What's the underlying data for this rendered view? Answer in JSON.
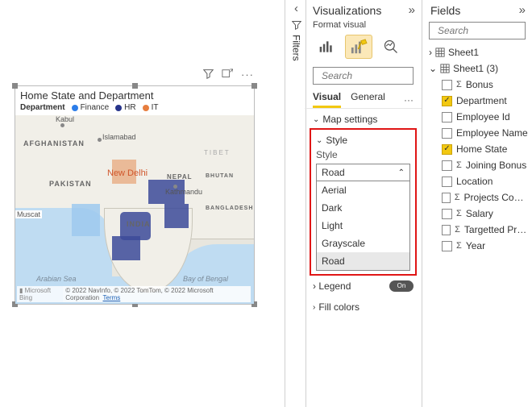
{
  "filters_tab": {
    "label": "Filters"
  },
  "chart": {
    "title": "Home State and Department",
    "legend_label": "Department",
    "legend_items": [
      {
        "label": "Finance",
        "color": "#2b7de9"
      },
      {
        "label": "HR",
        "color": "#27348b"
      },
      {
        "label": "IT",
        "color": "#e77e3f"
      }
    ],
    "map_labels": {
      "afghanistan": "AFGHANISTAN",
      "pakistan": "PAKISTAN",
      "india": "INDIA",
      "nepal": "NEPAL",
      "bhutan": "BHUTAN",
      "bangladesh": "BANGLADESH",
      "tibet": "TIBET",
      "kabul": "Kabul",
      "islamabad": "Islamabad",
      "newdelhi": "New Delhi",
      "kathmandu": "Kathmandu",
      "muscat": "Muscat",
      "arabian_sea": "Arabian Sea",
      "bay_of_bengal": "Bay of Bengal"
    },
    "bing": "Microsoft Bing",
    "credits": "© 2022 NavInfo, © 2022 TomTom, © 2022 Microsoft Corporation",
    "terms": "Terms",
    "chart_data": {
      "type": "map",
      "title": "Home State and Department",
      "series_field": "Department",
      "location_field": "Home State",
      "series": [
        {
          "name": "Finance",
          "color": "#2b7de9"
        },
        {
          "name": "HR",
          "color": "#27348b"
        },
        {
          "name": "IT",
          "color": "#e77e3f"
        }
      ],
      "note": "Filled map of India colored by Department per Home State; exact state→department pairs not legible from screenshot"
    }
  },
  "viz": {
    "panel_title": "Visualizations",
    "format_visual": "Format visual",
    "search_placeholder": "Search",
    "tab_visual": "Visual",
    "tab_general": "General",
    "map_settings": "Map settings",
    "style_group": "Style",
    "style_label": "Style",
    "style_value": "Road",
    "style_options": [
      "Aerial",
      "Dark",
      "Light",
      "Grayscale",
      "Road"
    ],
    "legend_label": "Legend",
    "legend_toggle": "On",
    "fill_colors": "Fill colors"
  },
  "fields": {
    "panel_title": "Fields",
    "search_placeholder": "Search",
    "table1": "Sheet1",
    "table2": "Sheet1 (3)",
    "items": [
      {
        "label": "Bonus",
        "checked": false,
        "sigma": true
      },
      {
        "label": "Department",
        "checked": true,
        "sigma": false
      },
      {
        "label": "Employee Id",
        "checked": false,
        "sigma": false
      },
      {
        "label": "Employee Name",
        "checked": false,
        "sigma": false
      },
      {
        "label": "Home State",
        "checked": true,
        "sigma": false
      },
      {
        "label": "Joining Bonus",
        "checked": false,
        "sigma": true
      },
      {
        "label": "Location",
        "checked": false,
        "sigma": false
      },
      {
        "label": "Projects Complet...",
        "checked": false,
        "sigma": true
      },
      {
        "label": "Salary",
        "checked": false,
        "sigma": true
      },
      {
        "label": "Targetted Projects",
        "checked": false,
        "sigma": true
      },
      {
        "label": "Year",
        "checked": false,
        "sigma": true
      }
    ]
  }
}
